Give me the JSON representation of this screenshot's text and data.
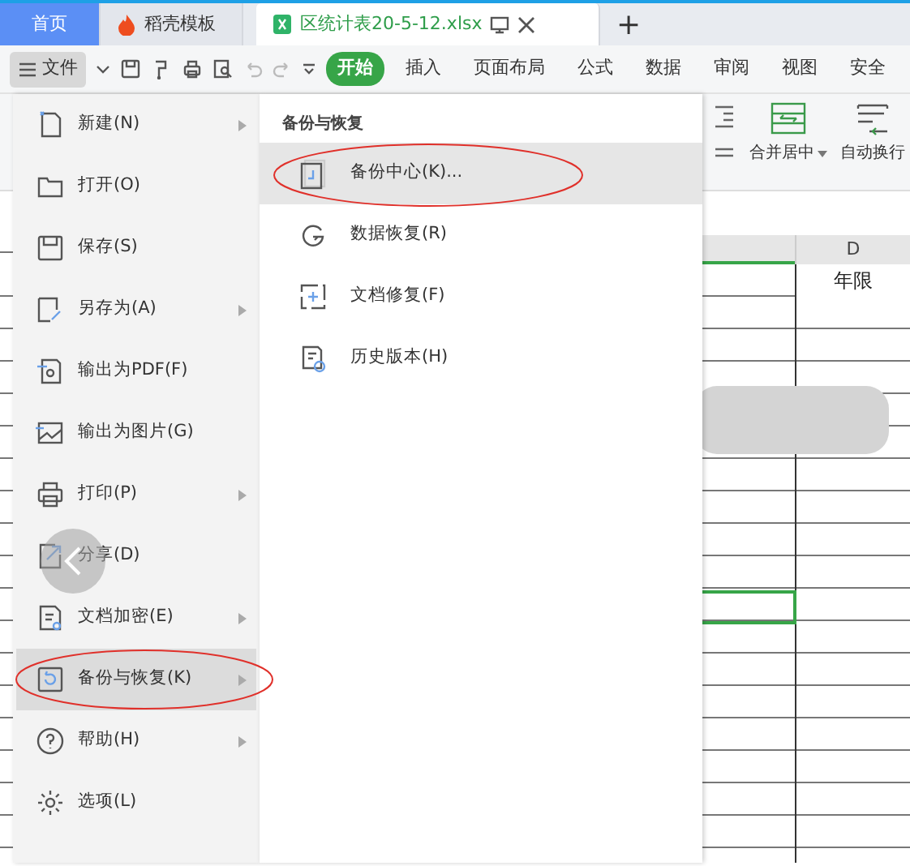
{
  "tabs": [
    {
      "label": "首页",
      "kind": "home",
      "selected": false
    },
    {
      "label": "稻壳模板",
      "kind": "template",
      "selected": false
    },
    {
      "label": "区统计表20-5-12.xlsx",
      "kind": "sheet",
      "selected": true
    }
  ],
  "new_tab": "+",
  "toolbar": {
    "file_button": "文件",
    "ribbon_tabs": [
      {
        "label": "开始",
        "selected": true
      },
      {
        "label": "插入",
        "selected": false
      },
      {
        "label": "页面布局",
        "selected": false
      },
      {
        "label": "公式",
        "selected": false
      },
      {
        "label": "数据",
        "selected": false
      },
      {
        "label": "审阅",
        "selected": false
      },
      {
        "label": "视图",
        "selected": false
      },
      {
        "label": "安全",
        "selected": false
      }
    ]
  },
  "ribbon": {
    "buttons": [
      {
        "label": "合并居中",
        "has_dropdown": true
      },
      {
        "label": "自动换行",
        "has_dropdown": false
      }
    ]
  },
  "sheet": {
    "column_header": "D",
    "header_cell": "年限"
  },
  "file_menu": {
    "items": [
      {
        "label": "新建(N)",
        "has_submenu": true,
        "selected": false
      },
      {
        "label": "打开(O)",
        "has_submenu": false,
        "selected": false
      },
      {
        "label": "保存(S)",
        "has_submenu": false,
        "selected": false
      },
      {
        "label": "另存为(A)",
        "has_submenu": true,
        "selected": false
      },
      {
        "label": "输出为PDF(F)",
        "has_submenu": false,
        "selected": false
      },
      {
        "label": "输出为图片(G)",
        "has_submenu": false,
        "selected": false
      },
      {
        "label": "打印(P)",
        "has_submenu": true,
        "selected": false
      },
      {
        "label": "分享(D)",
        "has_submenu": false,
        "selected": false
      },
      {
        "label": "文档加密(E)",
        "has_submenu": true,
        "selected": false
      },
      {
        "label": "备份与恢复(K)",
        "has_submenu": true,
        "selected": true
      },
      {
        "label": "帮助(H)",
        "has_submenu": true,
        "selected": false
      },
      {
        "label": "选项(L)",
        "has_submenu": false,
        "selected": false
      }
    ]
  },
  "submenu": {
    "title": "备份与恢复",
    "items": [
      {
        "label": "备份中心(K)...",
        "selected": true
      },
      {
        "label": "数据恢复(R)",
        "selected": false
      },
      {
        "label": "文档修复(F)",
        "selected": false
      },
      {
        "label": "历史版本(H)",
        "selected": false
      }
    ]
  }
}
